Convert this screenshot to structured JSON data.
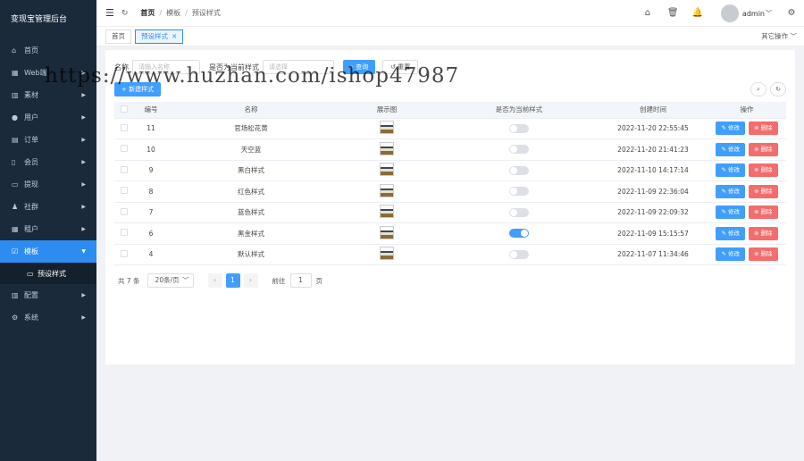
{
  "app": {
    "title": "变现宝管理后台"
  },
  "sidebar": {
    "items": [
      {
        "label": "首页",
        "icon": "home-icon",
        "glyph": "⌂",
        "arrow": false
      },
      {
        "label": "Web端",
        "icon": "grid-icon",
        "glyph": "▦",
        "arrow": true
      },
      {
        "label": "素材",
        "icon": "bar-chart-icon",
        "glyph": "▥",
        "arrow": true
      },
      {
        "label": "用户",
        "icon": "user-icon",
        "glyph": "●",
        "arrow": true
      },
      {
        "label": "订单",
        "icon": "order-icon",
        "glyph": "▤",
        "arrow": true
      },
      {
        "label": "会员",
        "icon": "member-icon",
        "glyph": "▯",
        "arrow": true
      },
      {
        "label": "提现",
        "icon": "wallet-icon",
        "glyph": "▭",
        "arrow": true
      },
      {
        "label": "社群",
        "icon": "group-icon",
        "glyph": "♟",
        "arrow": true
      },
      {
        "label": "租户",
        "icon": "tenant-icon",
        "glyph": "▦",
        "arrow": true
      }
    ],
    "active_item": {
      "label": "模板",
      "icon": "template-icon",
      "glyph": "☑"
    },
    "active_sub": {
      "label": "预设样式",
      "icon": "monitor-icon",
      "glyph": "▭"
    },
    "items_after": [
      {
        "label": "配置",
        "icon": "chart-icon",
        "glyph": "▥"
      },
      {
        "label": "系统",
        "icon": "settings-icon",
        "glyph": "⚙"
      }
    ]
  },
  "header": {
    "breadcrumb": [
      "首页",
      "模板",
      "预设样式"
    ],
    "user": "admin"
  },
  "tags": {
    "home": "首页",
    "current": "预设样式",
    "other_ops": "其它操作"
  },
  "search": {
    "name_label": "名称",
    "name_placeholder": "请输入名称",
    "current_label": "是否为当前样式",
    "current_placeholder": "请选择",
    "query": "查询",
    "reset": "重置",
    "add": "+ 新建样式"
  },
  "table": {
    "headers": [
      "编号",
      "名称",
      "展示图",
      "是否为当前样式",
      "创建时间",
      "操作"
    ],
    "edit_label": "✎ 修改",
    "delete_label": "⊗ 删除",
    "rows": [
      {
        "id": "11",
        "name": "官场松花黄",
        "current": false,
        "created": "2022-11-20 22:55:45"
      },
      {
        "id": "10",
        "name": "天空蓝",
        "current": false,
        "created": "2022-11-20 21:41:23"
      },
      {
        "id": "9",
        "name": "黑白样式",
        "current": false,
        "created": "2022-11-10 14:17:14"
      },
      {
        "id": "8",
        "name": "红色样式",
        "current": false,
        "created": "2022-11-09 22:36:04"
      },
      {
        "id": "7",
        "name": "蓝色样式",
        "current": false,
        "created": "2022-11-09 22:09:32"
      },
      {
        "id": "6",
        "name": "黑金样式",
        "current": true,
        "created": "2022-11-09 15:15:57"
      },
      {
        "id": "4",
        "name": "默认样式",
        "current": false,
        "created": "2022-11-07 11:34:46"
      }
    ]
  },
  "pagination": {
    "total": "共 7 条",
    "page_size": "20条/页",
    "current_page": "1",
    "jump_prefix": "前往",
    "jump_value": "1",
    "jump_suffix": "页"
  },
  "watermark": "https://www.huzhan.com/ishop47987",
  "colors": {
    "sidebar_bg": "#1b2a3a",
    "primary": "#409eff",
    "danger": "#f56c6c",
    "active_menu": "#2d8cf0"
  }
}
